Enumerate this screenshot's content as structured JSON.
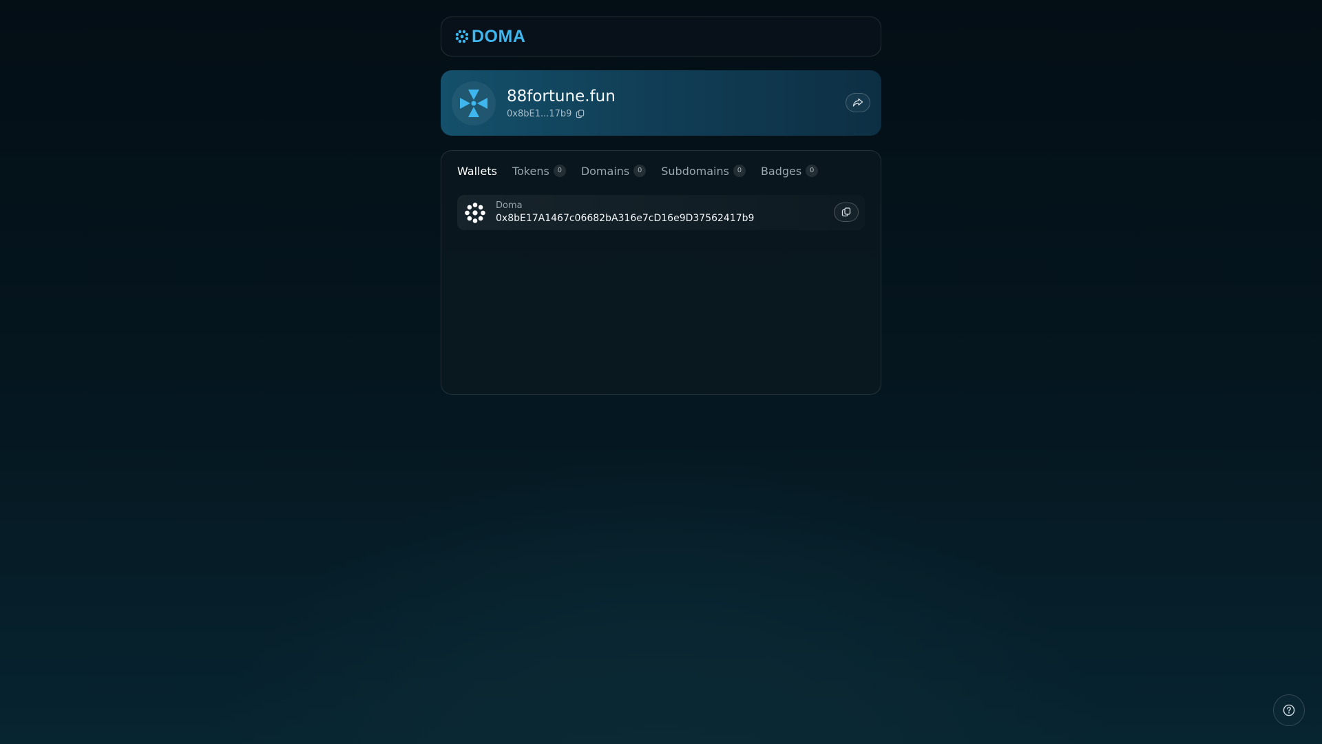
{
  "header": {
    "brand": "DOMA",
    "brand_color": "#3fb6ee"
  },
  "profile": {
    "name": "88fortune.fun",
    "short_address": "0x8bE1...17b9",
    "avatar_icon": "doma-x-icon",
    "copy_icon": "copy-icon",
    "share_icon": "share-icon"
  },
  "tabs": [
    {
      "label": "Wallets",
      "active": true
    },
    {
      "label": "Tokens",
      "count": "0"
    },
    {
      "label": "Domains",
      "count": "0"
    },
    {
      "label": "Subdomains",
      "count": "0"
    },
    {
      "label": "Badges",
      "count": "0"
    }
  ],
  "wallets": [
    {
      "chain": "Doma",
      "address": "0x8bE17A1467c06682bA316e7cD16e9D37562417b9",
      "icon": "doma-flower-icon"
    }
  ],
  "help": {
    "icon": "help-icon"
  }
}
